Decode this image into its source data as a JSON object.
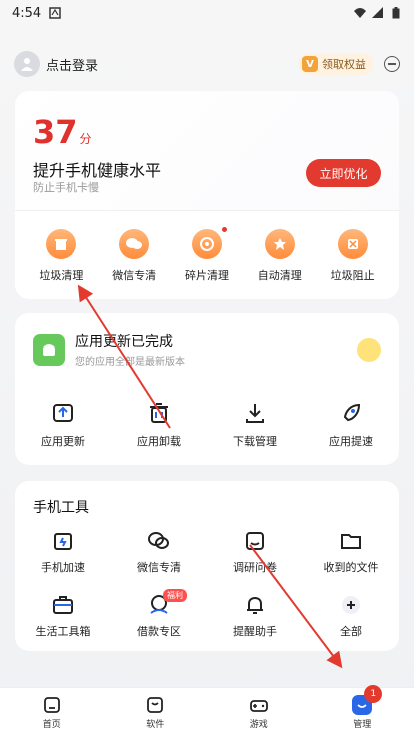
{
  "status": {
    "time": "4:54"
  },
  "topbar": {
    "login_text": "点击登录",
    "benefit_text": "领取权益",
    "vip_badge_text": "V"
  },
  "score_card": {
    "score_value": "37",
    "score_unit": "分",
    "title": "提升手机健康水平",
    "subtitle": "防止手机卡慢",
    "optimize_label": "立即优化"
  },
  "quick_tools": [
    {
      "label": "垃圾清理",
      "icon": "trash-icon"
    },
    {
      "label": "微信专清",
      "icon": "wechat-icon"
    },
    {
      "label": "碎片清理",
      "icon": "fragment-icon"
    },
    {
      "label": "自动清理",
      "icon": "auto-clean-icon"
    },
    {
      "label": "垃圾阻止",
      "icon": "block-icon"
    }
  ],
  "update_card": {
    "title": "应用更新已完成",
    "subtitle": "您的应用全部是最新版本",
    "actions": [
      {
        "label": "应用更新",
        "icon": "update-icon"
      },
      {
        "label": "应用卸载",
        "icon": "uninstall-icon"
      },
      {
        "label": "下载管理",
        "icon": "download-icon"
      },
      {
        "label": "应用提速",
        "icon": "rocket-icon"
      }
    ]
  },
  "tools_card": {
    "title": "手机工具",
    "items": [
      {
        "label": "手机加速",
        "icon": "battery-icon"
      },
      {
        "label": "微信专清",
        "icon": "chat-icon"
      },
      {
        "label": "调研问卷",
        "icon": "survey-icon"
      },
      {
        "label": "收到的文件",
        "icon": "folder-icon"
      },
      {
        "label": "生活工具箱",
        "icon": "toolbox-icon"
      },
      {
        "label": "借款专区",
        "icon": "loan-icon",
        "tag": "福利"
      },
      {
        "label": "提醒助手",
        "icon": "bell-icon"
      },
      {
        "label": "全部",
        "icon": "plus-icon"
      }
    ]
  },
  "bottom_nav": {
    "items": [
      {
        "label": "首页"
      },
      {
        "label": "软件"
      },
      {
        "label": "游戏"
      },
      {
        "label": "管理",
        "badge": "1"
      }
    ]
  },
  "colors": {
    "accent_red": "#e23a2f",
    "accent_blue": "#2a66e8",
    "orange": "#ff8c3b"
  }
}
